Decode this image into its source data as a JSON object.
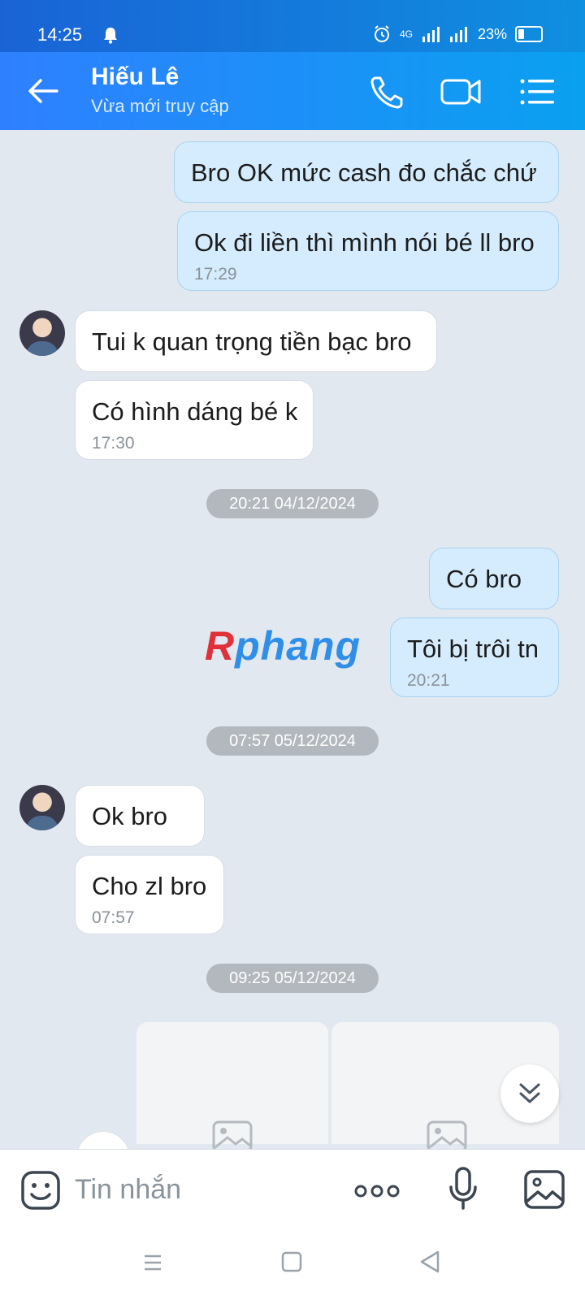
{
  "status_bar": {
    "time": "14:25",
    "network": "4G",
    "battery": "23%"
  },
  "header": {
    "contact_name": "Hiếu Lê",
    "status": "Vừa mới truy cập"
  },
  "messages": [
    {
      "dir": "out",
      "text": "Bro OK mức cash đo chắc chứ"
    },
    {
      "dir": "out",
      "text": "Ok đi liền thì mình nói bé ll bro",
      "time": "17:29"
    },
    {
      "dir": "in",
      "text": "Tui k quan trọng tiền bạc bro"
    },
    {
      "dir": "in",
      "text": "Có hình dáng bé k",
      "time": "17:30"
    },
    {
      "dir": "out",
      "text": "Có bro"
    },
    {
      "dir": "out",
      "text": "Tôi bị trôi tn",
      "time": "20:21"
    },
    {
      "dir": "in",
      "text": "Ok bro"
    },
    {
      "dir": "in",
      "text": "Cho zl bro",
      "time": "07:57"
    }
  ],
  "date_separators": [
    "20:21 04/12/2024",
    "07:57 05/12/2024",
    "09:25 05/12/2024"
  ],
  "watermark": {
    "first": "R",
    "rest": "phang"
  },
  "input": {
    "placeholder": "Tin nhắn"
  }
}
